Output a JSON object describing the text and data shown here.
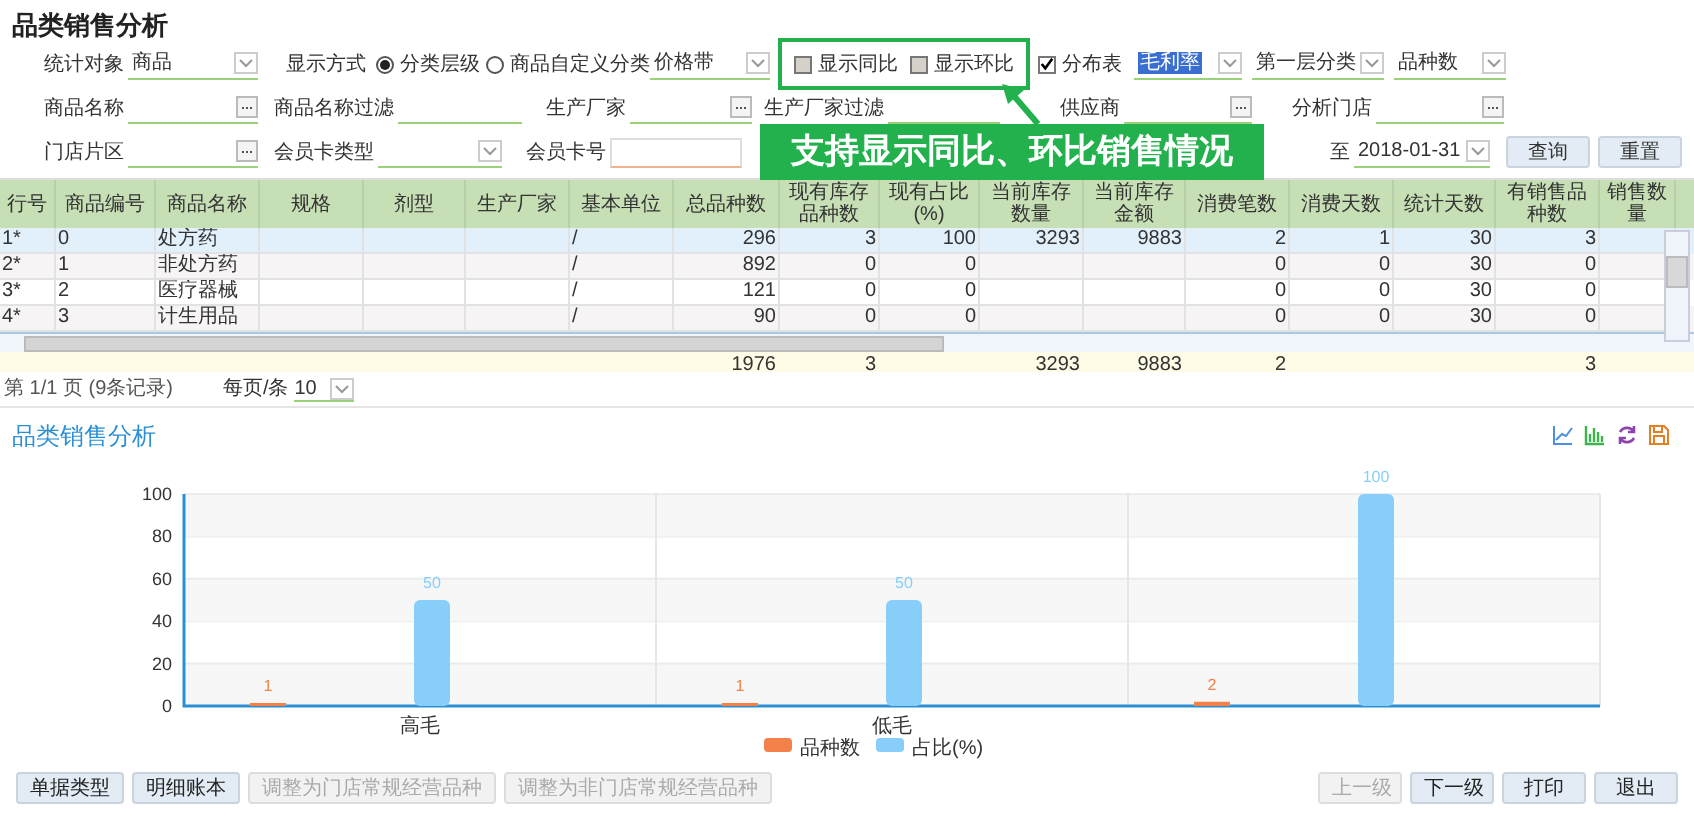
{
  "title": "品类销售分析",
  "filters": [
    [
      {
        "kind": "select",
        "label": "统计对象",
        "value": "商品"
      },
      {
        "kind": "radio",
        "label": "显示方式",
        "options": [
          {
            "label": "分类层级",
            "selected": true
          },
          {
            "label": "商品自定义分类",
            "selected": false
          }
        ]
      },
      {
        "kind": "select",
        "value": "价格带"
      },
      {
        "kind": "checkgroup",
        "options": [
          {
            "label": "显示同比",
            "checked": false
          },
          {
            "label": "显示环比",
            "checked": false
          }
        ]
      },
      {
        "kind": "checkbox",
        "label": "分布表",
        "checked": true
      },
      {
        "kind": "select",
        "value": "毛利率",
        "highlighted": true
      },
      {
        "kind": "select",
        "value": "第一层分类"
      },
      {
        "kind": "select",
        "value": "品种数"
      }
    ],
    [
      {
        "kind": "lookup",
        "label": "商品名称"
      },
      {
        "kind": "field",
        "label": "商品名称过滤"
      },
      {
        "kind": "lookup",
        "label": "生产厂家"
      },
      {
        "kind": "field",
        "label": "生产厂家过滤"
      },
      {
        "kind": "lookup",
        "label": "供应商"
      },
      {
        "kind": "lookup",
        "label": "分析门店"
      }
    ],
    [
      {
        "kind": "lookup",
        "label": "门店片区"
      },
      {
        "kind": "select",
        "label": "会员卡类型"
      },
      {
        "kind": "field",
        "label": "会员卡号",
        "focused": true
      },
      {
        "kind": "select",
        "label": "至",
        "value": "2018-01-31"
      },
      {
        "kind": "button",
        "label": "查询"
      },
      {
        "kind": "button",
        "label": "重置"
      }
    ]
  ],
  "callout": "支持显示同比、环比销售情况",
  "table": {
    "columns": [
      "行号",
      "商品编号",
      "商品名称",
      "规格",
      "剂型",
      "生产厂家",
      "基本单位",
      "总品种数",
      "现有库存品种数",
      "现有占比(%)",
      "当前库存数量",
      "当前库存金额",
      "消费笔数",
      "消费天数",
      "统计天数",
      "有销售品种数",
      "销售数量"
    ],
    "rows": [
      {
        "selected": true,
        "cells": [
          "1*",
          "0",
          "处方药",
          null,
          null,
          null,
          "/",
          "296",
          "3",
          "100",
          "3293",
          "9883",
          "2",
          "1",
          "30",
          "3",
          null
        ]
      },
      {
        "selected": false,
        "cells": [
          "2*",
          "1",
          "非处方药",
          null,
          null,
          null,
          "/",
          "892",
          "0",
          "0",
          null,
          null,
          "0",
          "0",
          "30",
          "0",
          null
        ]
      },
      {
        "selected": false,
        "cells": [
          "3*",
          "2",
          "医疗器械",
          null,
          null,
          null,
          "/",
          "121",
          "0",
          "0",
          null,
          null,
          "0",
          "0",
          "30",
          "0",
          null
        ]
      },
      {
        "selected": false,
        "cells": [
          "4*",
          "3",
          "计生用品",
          null,
          null,
          null,
          "/",
          "90",
          "0",
          "0",
          null,
          null,
          "0",
          "0",
          "30",
          "0",
          null
        ]
      }
    ],
    "totals": {
      "total_items": "1976",
      "stock_items": "3",
      "stock_qty": "3293",
      "stock_amount": "9883",
      "sales_count": "2",
      "sold_items": "3"
    }
  },
  "pager": {
    "info": "第 1/1 页 (9条记录)",
    "per_page_label": "每页/条",
    "per_page": "10"
  },
  "chart": {
    "title": "品类销售分析",
    "chart_data": {
      "type": "bar",
      "categories": [
        "高毛",
        "低毛",
        null
      ],
      "series": [
        {
          "name": "品种数",
          "color": "#f4804a",
          "values": [
            1,
            1,
            2
          ]
        },
        {
          "name": "占比(%)",
          "color": "#87cefa",
          "values": [
            50,
            50,
            100
          ]
        }
      ],
      "ylim": [
        0,
        100
      ],
      "yticks": [
        {
          "value": 0,
          "label": "0"
        },
        {
          "value": 20,
          "label": "20"
        },
        {
          "value": 40,
          "label": "40"
        },
        {
          "value": 60,
          "label": "60"
        },
        {
          "value": 80,
          "label": "80"
        },
        {
          "value": 100,
          "label": "100"
        }
      ],
      "data_labels": true,
      "grid": true,
      "legend": true
    }
  },
  "buttons_left": [
    {
      "label": "单据类型",
      "disabled": false
    },
    {
      "label": "明细账本",
      "disabled": false
    },
    {
      "label": "调整为门店常规经营品种",
      "disabled": true
    },
    {
      "label": "调整为非门店常规经营品种",
      "disabled": true
    }
  ],
  "buttons_right": [
    {
      "label": "上一级",
      "disabled": true
    },
    {
      "label": "下一级",
      "disabled": false
    },
    {
      "label": "打印",
      "disabled": false
    },
    {
      "label": "退出",
      "disabled": false
    }
  ]
}
